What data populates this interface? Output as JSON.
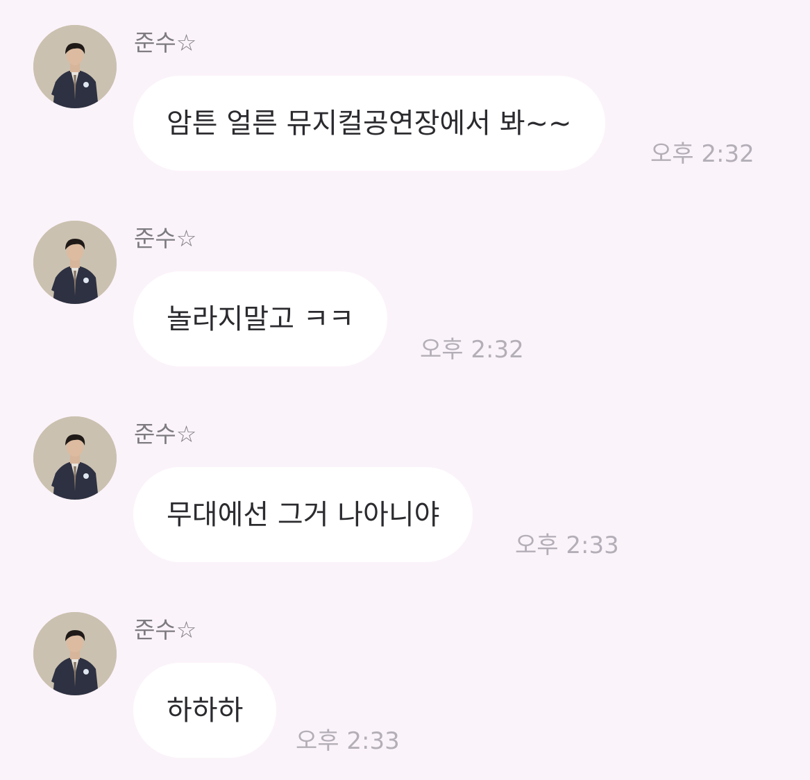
{
  "conversation": {
    "messages": [
      {
        "sender": "준수☆",
        "text": "암튼 얼른 뮤지컬공연장에서 봐~~",
        "time": "오후 2:32"
      },
      {
        "sender": "준수☆",
        "text": "놀라지말고 ㅋㅋ",
        "time": "오후 2:32"
      },
      {
        "sender": "준수☆",
        "text": "무대에선 그거 나아니야",
        "time": "오후 2:33"
      },
      {
        "sender": "준수☆",
        "text": "하하하",
        "time": "오후 2:33"
      }
    ]
  },
  "colors": {
    "background": "#fbf3fa",
    "bubble": "#ffffff",
    "sender_text": "#7d7b80",
    "message_text": "#2b2b2f",
    "timestamp": "#b3aeb7"
  },
  "icons": {
    "avatar": "profile-photo"
  }
}
